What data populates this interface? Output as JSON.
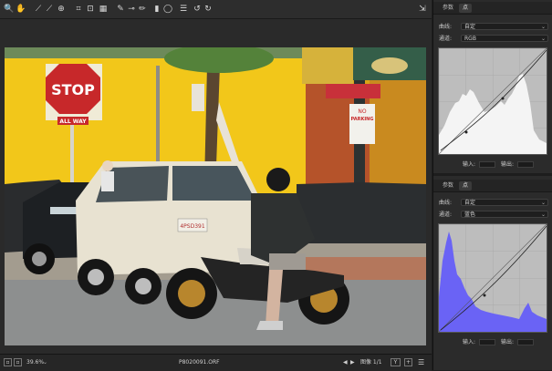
{
  "toolbar": {
    "tools": [
      {
        "name": "zoom-icon",
        "glyph": "🔍"
      },
      {
        "name": "hand-icon",
        "glyph": "✋"
      },
      {
        "name": "white-balance-icon",
        "glyph": "⟋"
      },
      {
        "name": "color-sampler-icon",
        "glyph": "⟋"
      },
      {
        "name": "targeted-adjust-icon",
        "glyph": "⊕"
      },
      {
        "name": "crop-icon",
        "glyph": "⌗"
      },
      {
        "name": "straighten-icon",
        "glyph": "⊡"
      },
      {
        "name": "transform-icon",
        "glyph": "▦"
      },
      {
        "name": "spot-removal-icon",
        "glyph": "✎"
      },
      {
        "name": "red-eye-icon",
        "glyph": "⊸"
      },
      {
        "name": "brush-icon",
        "glyph": "✏"
      },
      {
        "name": "gradient-filter-icon",
        "glyph": "▮"
      },
      {
        "name": "radial-filter-icon",
        "glyph": "◯"
      },
      {
        "name": "list-icon",
        "glyph": "☰"
      },
      {
        "name": "rotate-ccw-icon",
        "glyph": "↺"
      },
      {
        "name": "rotate-cw-icon",
        "glyph": "↻"
      }
    ],
    "export_glyph": "⇲"
  },
  "status": {
    "zoom": "39.6%",
    "filename": "P8020091.ORF",
    "image_counter": "图像 1/1",
    "prev_glyph": "◀",
    "next_glyph": "▶",
    "y_glyph": "Y"
  },
  "panel_top": {
    "tabs": [
      "参数",
      "点"
    ],
    "curve_label": "曲线:",
    "curve_value": "自定",
    "channel_label": "通道:",
    "channel_value": "RGB",
    "input_label": "输入:",
    "output_label": "输出:"
  },
  "panel_bottom": {
    "tabs": [
      "参数",
      "点"
    ],
    "curve_label": "曲线:",
    "curve_value": "自定",
    "channel_label": "通道:",
    "channel_value": "蓝色",
    "input_label": "输入:",
    "output_label": "输出:"
  },
  "photo_signs": {
    "stop": "STOP",
    "all_way": "ALL WAY",
    "no": "NO",
    "parking": "PARKING",
    "plate": "4PSD391"
  },
  "colors": {
    "accent_blue": "#6a63f5",
    "wall_yellow": "#f2c71a"
  }
}
